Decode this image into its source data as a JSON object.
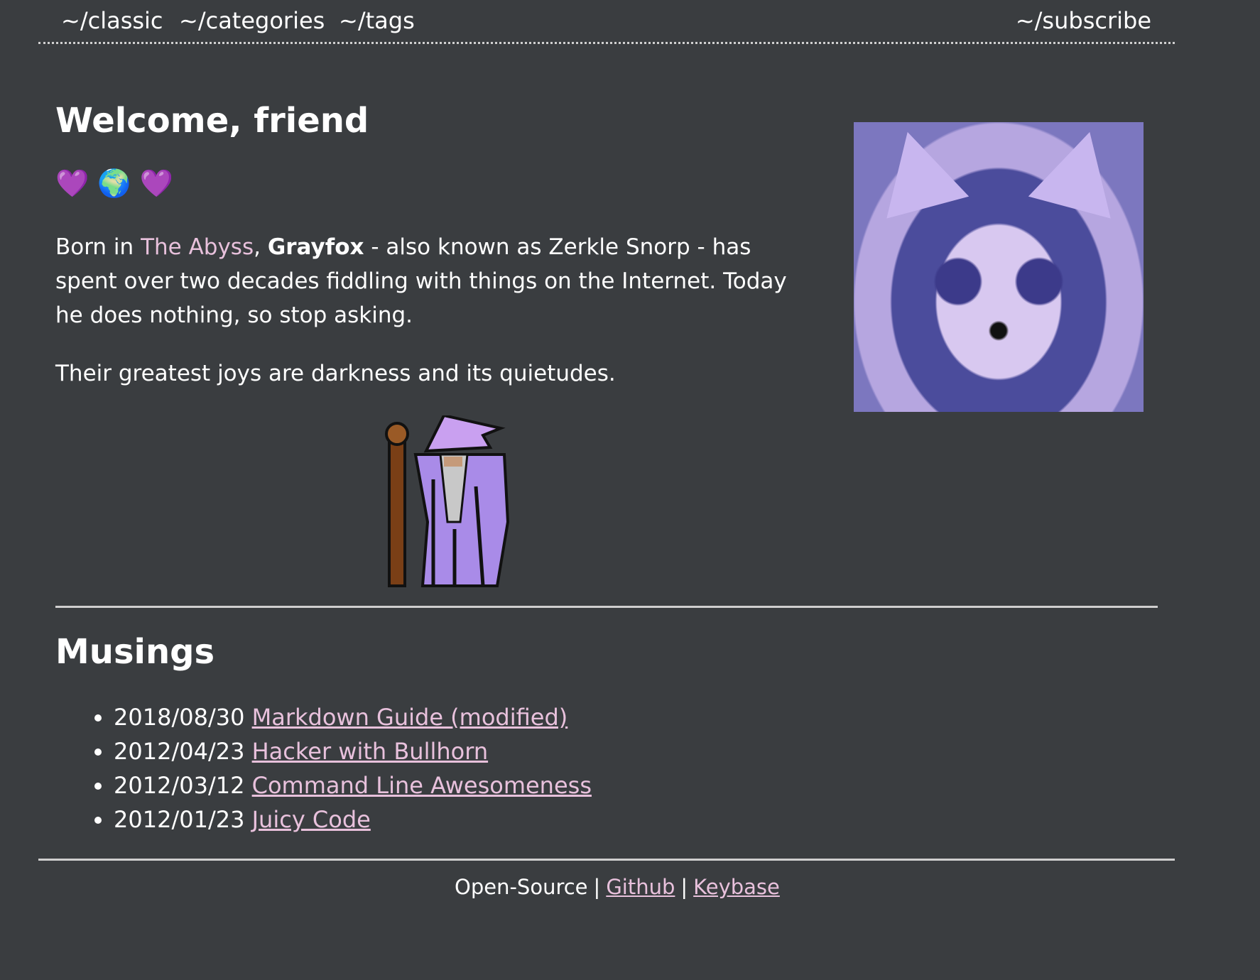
{
  "nav": {
    "classic": "~/classic",
    "categories": "~/categories",
    "tags": "~/tags",
    "subscribe": "~/subscribe"
  },
  "welcome": {
    "title": "Welcome, friend",
    "emoji": [
      "💜",
      "🌍",
      "💜"
    ],
    "bio_prefix": "Born in ",
    "bio_link": "The Abyss",
    "bio_comma": ", ",
    "bio_name": "Grayfox",
    "bio_rest": " - also known as Zerkle Snorp - has spent over two decades fiddling with things on the Internet. Today he does nothing, so stop asking.",
    "joys": "Their greatest joys are darkness and its quietudes."
  },
  "musings": {
    "title": "Musings",
    "posts": [
      {
        "date": "2018/08/30",
        "title": "Markdown Guide (modified)"
      },
      {
        "date": "2012/04/23",
        "title": "Hacker with Bullhorn"
      },
      {
        "date": "2012/03/12",
        "title": "Command Line Awesomeness"
      },
      {
        "date": "2012/01/23",
        "title": "Juicy Code"
      }
    ]
  },
  "footer": {
    "open_source": "Open-Source",
    "github": "Github",
    "keybase": "Keybase",
    "sep": "|"
  },
  "colors": {
    "background": "#3a3d40",
    "link": "#e8c1dc",
    "text": "#ffffff"
  }
}
